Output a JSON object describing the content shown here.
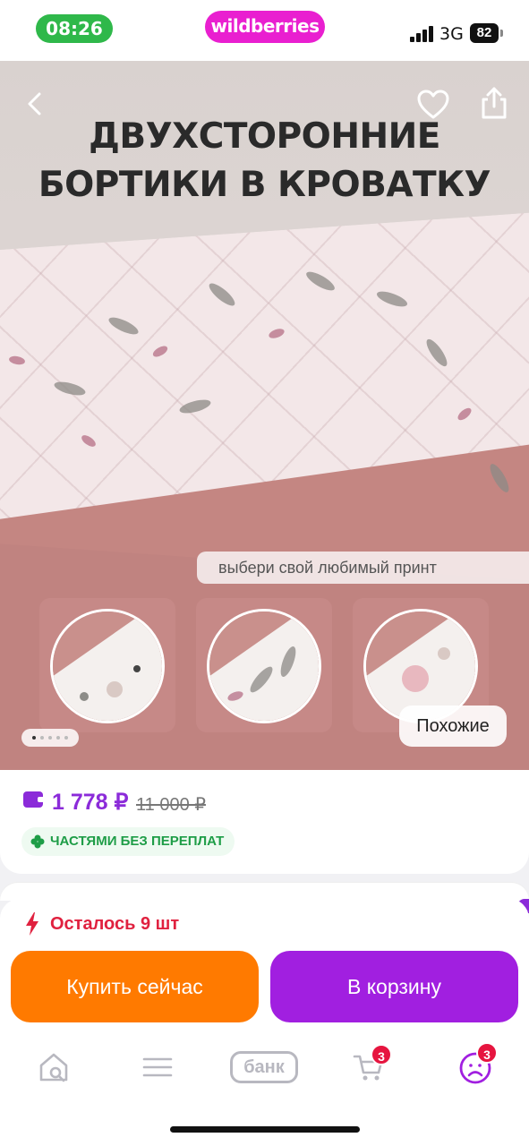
{
  "status_bar": {
    "time": "08:26",
    "brand": "wildberries",
    "network": "3G",
    "battery": "82"
  },
  "hero": {
    "title_line1": "ДВУХСТОРОННИЕ",
    "title_line2": "БОРТИКИ В КРОВАТКУ",
    "caption": "выбери свой любимый принт",
    "similar_label": "Похожие",
    "image_count": 5,
    "current_image": 1,
    "icons": {
      "back": "chevron-left-icon",
      "favorite": "heart-icon",
      "share": "share-icon"
    }
  },
  "price": {
    "current": "1 778 ₽",
    "old": "11 000 ₽",
    "installments": "ЧАСТЯМИ БЕЗ ПЕРЕПЛАТ"
  },
  "stock": {
    "text": "Осталось 9 шт"
  },
  "actions": {
    "buy_now": "Купить сейчас",
    "add_to_cart": "В корзину"
  },
  "tabbar": {
    "bank_label": "банк",
    "cart_badge": "3",
    "profile_badge": "3"
  },
  "colors": {
    "brand": "#e91fd0",
    "price_purple": "#8b2bd9",
    "buy_orange": "#ff7a00",
    "cart_purple": "#a11fe0",
    "stock_red": "#e0213f",
    "installments_green": "#1e9d47"
  }
}
